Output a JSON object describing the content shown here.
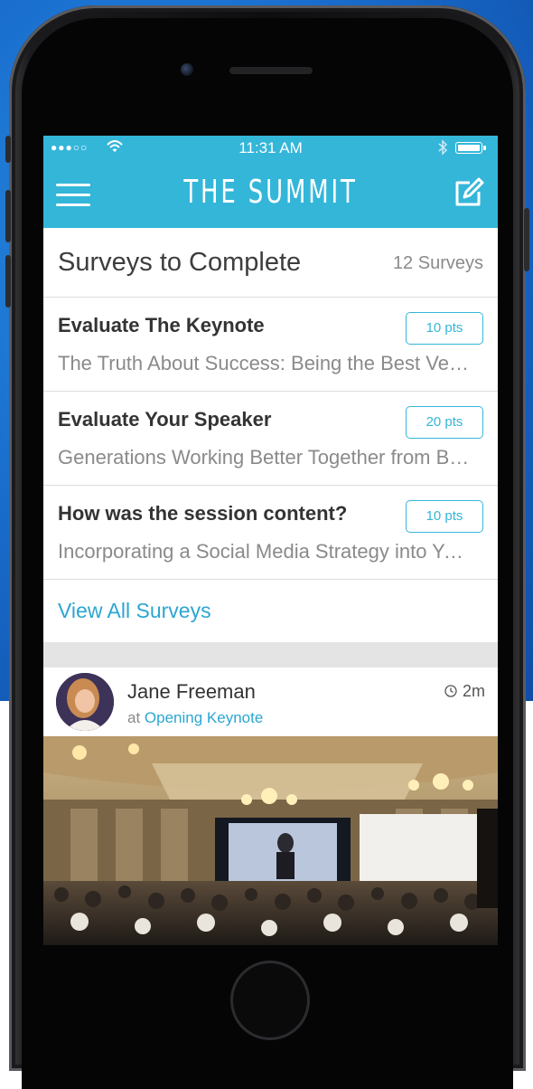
{
  "status_bar": {
    "signal": "●●●○○",
    "time": "11:31 AM"
  },
  "nav": {
    "title": "THE SUMMIT",
    "menu_icon": "hamburger-menu-icon",
    "compose_icon": "compose-icon"
  },
  "surveys": {
    "title": "Surveys to Complete",
    "count": "12 Surveys",
    "items": [
      {
        "title": "Evaluate The Keynote",
        "subtitle": "The Truth About Success: Being the Best Version of Yourself",
        "points": "10 pts"
      },
      {
        "title": "Evaluate Your Speaker",
        "subtitle": "Generations Working Better Together from Boomers to Millennials",
        "points": "20 pts"
      },
      {
        "title": "How was the session content?",
        "subtitle": "Incorporating a Social Media Strategy into Your Business",
        "points": "10 pts"
      }
    ],
    "view_all": "View All Surveys"
  },
  "feed": {
    "post": {
      "author": "Jane Freeman",
      "at_prefix": "at",
      "location": "Opening Keynote",
      "time": "2m"
    }
  },
  "colors": {
    "brand": "#34b6d9",
    "link": "#2ba6d2"
  }
}
